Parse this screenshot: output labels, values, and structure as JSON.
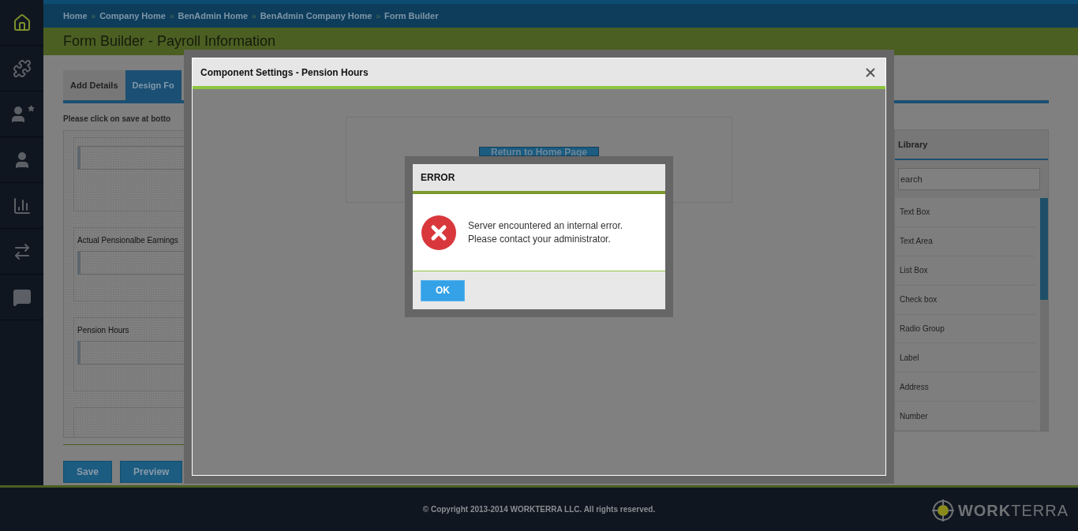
{
  "sidebar": {
    "items": [
      {
        "kind": "home",
        "selected": true
      },
      {
        "kind": "puzzle",
        "selected": false
      },
      {
        "kind": "person-star",
        "selected": false
      },
      {
        "kind": "person",
        "selected": false
      },
      {
        "kind": "chart",
        "selected": false
      },
      {
        "kind": "arrows",
        "selected": false
      },
      {
        "kind": "chat",
        "selected": false
      }
    ]
  },
  "breadcrumb": {
    "separator": "»",
    "items": [
      "Home",
      "Company Home",
      "BenAdmin Home",
      "BenAdmin Company Home",
      "Form Builder"
    ]
  },
  "page_title": "Form Builder - Payroll Information",
  "tabs": [
    {
      "label": "Add Details",
      "selected": false
    },
    {
      "label": "Design Fo",
      "selected": true
    }
  ],
  "instruction": "Please click on save at botto",
  "form_fields": [
    {
      "kind": "input"
    },
    {
      "label": "Actual Pensionalbe Earnings",
      "kind": "input"
    },
    {
      "label": "Pension Hours",
      "kind": "input"
    },
    {
      "kind": "empty"
    }
  ],
  "buttons": [
    "Save",
    "Preview"
  ],
  "library": {
    "title": "Library",
    "search_placeholder": "earch",
    "items": [
      "Text Box",
      "Text Area",
      "List Box",
      "Check box",
      "Radio Group",
      "Label",
      "Address",
      "Number"
    ]
  },
  "modal": {
    "title": "Component Settings - Pension Hours",
    "return_button": "Return to Home Page"
  },
  "error_dialog": {
    "title": "ERROR",
    "message": [
      "Server encountered an internal error.",
      "Please contact your administrator."
    ],
    "ok": "OK"
  },
  "footer": {
    "copyright": "© Copyright 2013-2014 WORKTERRA LLC. All rights reserved.",
    "logo": "**WORK**TERRA"
  }
}
